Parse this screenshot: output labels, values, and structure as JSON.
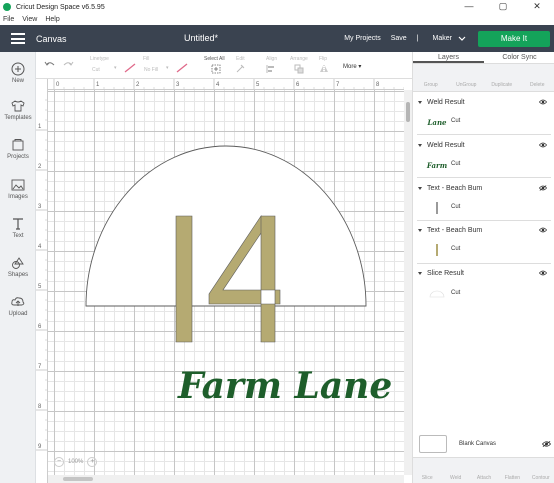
{
  "window": {
    "title": "Cricut Design Space  v6.5.95",
    "controls": [
      "—",
      "▢",
      "✕"
    ]
  },
  "menu": [
    "File",
    "View",
    "Help"
  ],
  "header": {
    "section": "Canvas",
    "project_title": "Untitled*",
    "my_projects": "My Projects",
    "save": "Save",
    "separator": "|",
    "machine": "Maker",
    "make_it": "Make It"
  },
  "leftbar": [
    {
      "icon": "plus-icon",
      "label": "New"
    },
    {
      "icon": "shirt-icon",
      "label": "Templates"
    },
    {
      "icon": "projects-icon",
      "label": "Projects"
    },
    {
      "icon": "image-icon",
      "label": "Images"
    },
    {
      "icon": "text-icon",
      "label": "Text"
    },
    {
      "icon": "shapes-icon",
      "label": "Shapes"
    },
    {
      "icon": "upload-icon",
      "label": "Upload"
    }
  ],
  "toolbar": {
    "linetype_label": "Linetype",
    "linetype_value": "Cut",
    "fill_label": "Fill",
    "fill_value": "No Fill",
    "select_all": "Select All",
    "edit": "Edit",
    "align": "Align",
    "arrange": "Arrange",
    "flip": "Flip",
    "more": "More"
  },
  "ruler": {
    "top_ticks": [
      "0",
      "1",
      "2",
      "3",
      "4",
      "5",
      "6",
      "7",
      "8"
    ],
    "left_ticks": [
      "1",
      "2",
      "3",
      "4",
      "5",
      "6",
      "7",
      "8",
      "9"
    ]
  },
  "canvas": {
    "number_text": "14",
    "script_text": "Farm Lane",
    "zoom": "100%",
    "colors": {
      "gold": "#b5aa72",
      "green": "#1e5e2b",
      "outline": "#5b5b5b"
    }
  },
  "panel": {
    "tabs": [
      "Layers",
      "Color Sync"
    ],
    "tools": [
      "Group",
      "UnGroup",
      "Duplicate",
      "Delete"
    ],
    "layers": [
      {
        "name": "Weld Result",
        "sub": "Cut",
        "thumb": "Lane",
        "eye": "visible"
      },
      {
        "name": "Weld Result",
        "sub": "Cut",
        "thumb": "Farm",
        "eye": "visible"
      },
      {
        "name": "Text - Beach Bum",
        "sub": "Cut",
        "thumb": "",
        "eye": "hidden"
      },
      {
        "name": "Text - Beach Bum",
        "sub": "Cut",
        "thumb": "",
        "eye": "visible"
      },
      {
        "name": "Slice Result",
        "sub": "Cut",
        "thumb": "",
        "eye": "visible"
      }
    ],
    "blank_canvas": "Blank Canvas",
    "bottom_tools": [
      "Slice",
      "Weld",
      "Attach",
      "Flatten",
      "Contour"
    ]
  }
}
